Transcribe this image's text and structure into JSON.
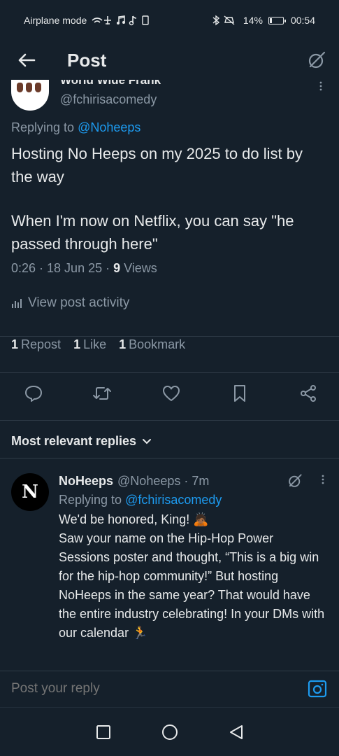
{
  "status_bar": {
    "left_text": "Airplane mode",
    "left_icons": "wifi airplane music tiktok sim",
    "right_icons": "bluetooth mute",
    "battery": "14%",
    "time": "00:54"
  },
  "top_bar": {
    "title": "Post"
  },
  "post": {
    "author_name_partial": "World Wide Frank",
    "author_handle": "@fchirisacomedy",
    "replying_prefix": "Replying to",
    "replying_mention": "@Noheeps",
    "text_p1": "Hosting No Heeps on my 2025 to do list by the way",
    "text_p2": "When I'm now on Netflix, you can say \"he passed through here\"",
    "meta_time": "0:26 · 18 Jun 25 · ",
    "meta_views_count": "9",
    "meta_views_label": " Views",
    "activity_label": "View post activity",
    "stats": {
      "reposts_count": "1",
      "reposts_label": "Repost",
      "likes_count": "1",
      "likes_label": "Like",
      "bookmarks_count": "1",
      "bookmarks_label": "Bookmark"
    }
  },
  "replies_header": {
    "sort_label": "Most relevant replies"
  },
  "reply": {
    "avatar_text": "N",
    "name": "NoHeeps",
    "handle_time": "@Noheeps · 7m",
    "replying_prefix": "Replying to",
    "replying_mention": "@fchirisacomedy",
    "text": "We'd be honored, King! 🙇🏾\nSaw your name on the Hip-Hop Power Sessions poster and thought, “This is a big win for the hip-hop community!” But hosting NoHeeps in the same year? That would have the entire industry celebrating! In your DMs with our calendar 🏃"
  },
  "compose": {
    "placeholder": "Post your reply"
  },
  "colors": {
    "background": "#15202b",
    "accent": "#1d9bf0",
    "secondary_text": "#8b98a5",
    "primary_text": "#e7e9ea"
  }
}
